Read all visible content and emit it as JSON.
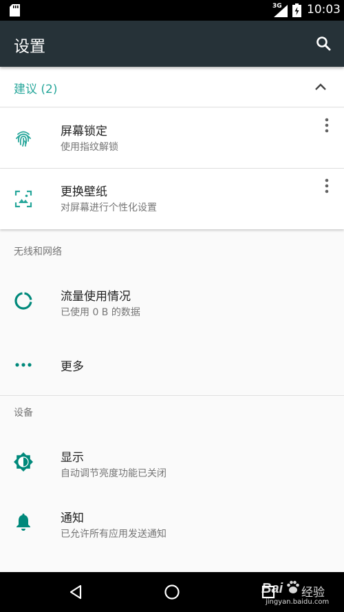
{
  "status_bar": {
    "network_type": "3G",
    "time": "10:03",
    "icons": [
      "sd-card-icon",
      "signal-icon",
      "battery-icon"
    ]
  },
  "app_bar": {
    "title": "设置",
    "action_icon": "search-icon"
  },
  "suggestions": {
    "header": "建议 (2)",
    "expanded": true,
    "items": [
      {
        "icon": "fingerprint-icon",
        "title": "屏幕锁定",
        "subtitle": "使用指纹解锁"
      },
      {
        "icon": "wallpaper-icon",
        "title": "更换壁纸",
        "subtitle": "对屏幕进行个性化设置"
      }
    ]
  },
  "sections": [
    {
      "header": "无线和网络",
      "items": [
        {
          "icon": "data-usage-icon",
          "title": "流量使用情况",
          "subtitle": "已使用 0 B 的数据"
        },
        {
          "icon": "more-horiz-icon",
          "title": "更多",
          "subtitle": ""
        }
      ]
    },
    {
      "header": "设备",
      "items": [
        {
          "icon": "brightness-icon",
          "title": "显示",
          "subtitle": "自动调节亮度功能已关闭"
        },
        {
          "icon": "bell-icon",
          "title": "通知",
          "subtitle": "已允许所有应用发送通知"
        }
      ]
    }
  ],
  "nav_bar": {
    "buttons": [
      "back-icon",
      "home-icon",
      "recents-icon"
    ]
  },
  "watermark": {
    "brand": "Bai",
    "text": "经验",
    "url": "jingyan.baidu.com"
  },
  "colors": {
    "accent": "#26a69a",
    "app_bar": "#263238",
    "icon_teal": "#00897b",
    "background": "#fafafa"
  }
}
